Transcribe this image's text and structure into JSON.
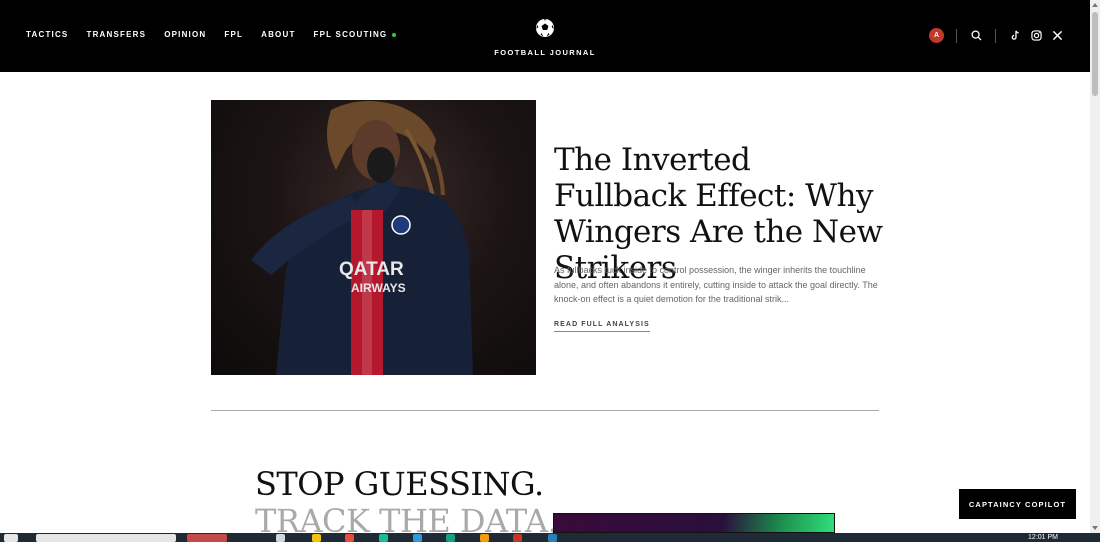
{
  "nav": {
    "items": [
      {
        "label": "TACTICS"
      },
      {
        "label": "TRANSFERS"
      },
      {
        "label": "OPINION"
      },
      {
        "label": "FPL"
      },
      {
        "label": "ABOUT"
      },
      {
        "label": "FPL SCOUTING"
      }
    ]
  },
  "brand": {
    "name": "FOOTBALL JOURNAL"
  },
  "user": {
    "avatar_initial": "A"
  },
  "hero": {
    "title": "The Inverted Fullback Effect: Why Wingers Are the New Strikers",
    "excerpt": "As fullbacks tuck inside to control possession, the winger inherits the touchline alone, and often abandons it entirely, cutting inside to attack the goal directly. The knock-on effect is a quiet demotion for the traditional strik...",
    "link_label": "READ FULL ANALYSIS",
    "image_jersey_text_1": "QATAR",
    "image_jersey_text_2": "AIRWAYS"
  },
  "promo": {
    "line1": "STOP GUESSING.",
    "line2": "TRACK THE DATA."
  },
  "copilot": {
    "label": "CAPTAINCY COPILOT"
  },
  "taskbar": {
    "time": "12:01 PM"
  },
  "colors": {
    "header_bg": "#000000",
    "accent_green": "#2ecc40",
    "avatar_red": "#c0392b"
  }
}
